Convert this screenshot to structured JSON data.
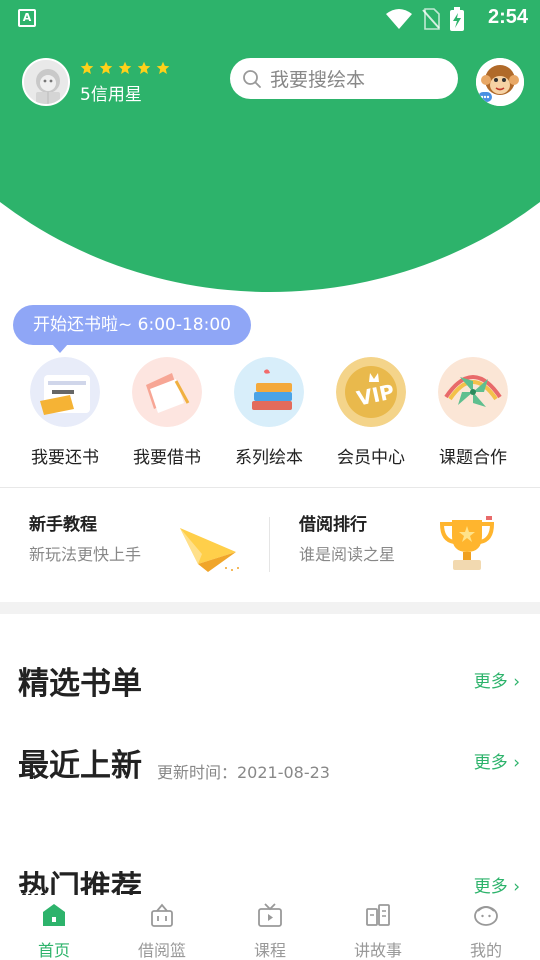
{
  "status_bar": {
    "time": "2:54"
  },
  "header": {
    "credit_text": "5信用星",
    "star_count": 5,
    "search_placeholder": "我要搜绘本"
  },
  "tooltip": {
    "text": "开始还书啦~  6:00-18:00"
  },
  "quick_menu": [
    {
      "label": "我要还书",
      "icon": "return-book-icon"
    },
    {
      "label": "我要借书",
      "icon": "borrow-book-icon"
    },
    {
      "label": "系列绘本",
      "icon": "book-series-icon"
    },
    {
      "label": "会员中心",
      "icon": "vip-icon"
    },
    {
      "label": "课题合作",
      "icon": "pinwheel-icon"
    }
  ],
  "cards": [
    {
      "title": "新手教程",
      "subtitle": "新玩法更快上手",
      "icon": "paper-plane-icon"
    },
    {
      "title": "借阅排行",
      "subtitle": "谁是阅读之星",
      "icon": "trophy-icon"
    }
  ],
  "sections": {
    "featured": {
      "title": "精选书单",
      "more": "更多"
    },
    "recent": {
      "title": "最近上新",
      "update": "更新时间：2021-08-23",
      "more": "更多"
    },
    "hot": {
      "title": "热门推荐",
      "more": "更多"
    }
  },
  "bottom_nav": [
    {
      "label": "首页",
      "active": true
    },
    {
      "label": "借阅篮",
      "active": false
    },
    {
      "label": "课程",
      "active": false
    },
    {
      "label": "讲故事",
      "active": false
    },
    {
      "label": "我的",
      "active": false
    }
  ],
  "colors": {
    "brand": "#2db36b",
    "tooltip": "#8fa6f6",
    "inactive": "#999999"
  }
}
